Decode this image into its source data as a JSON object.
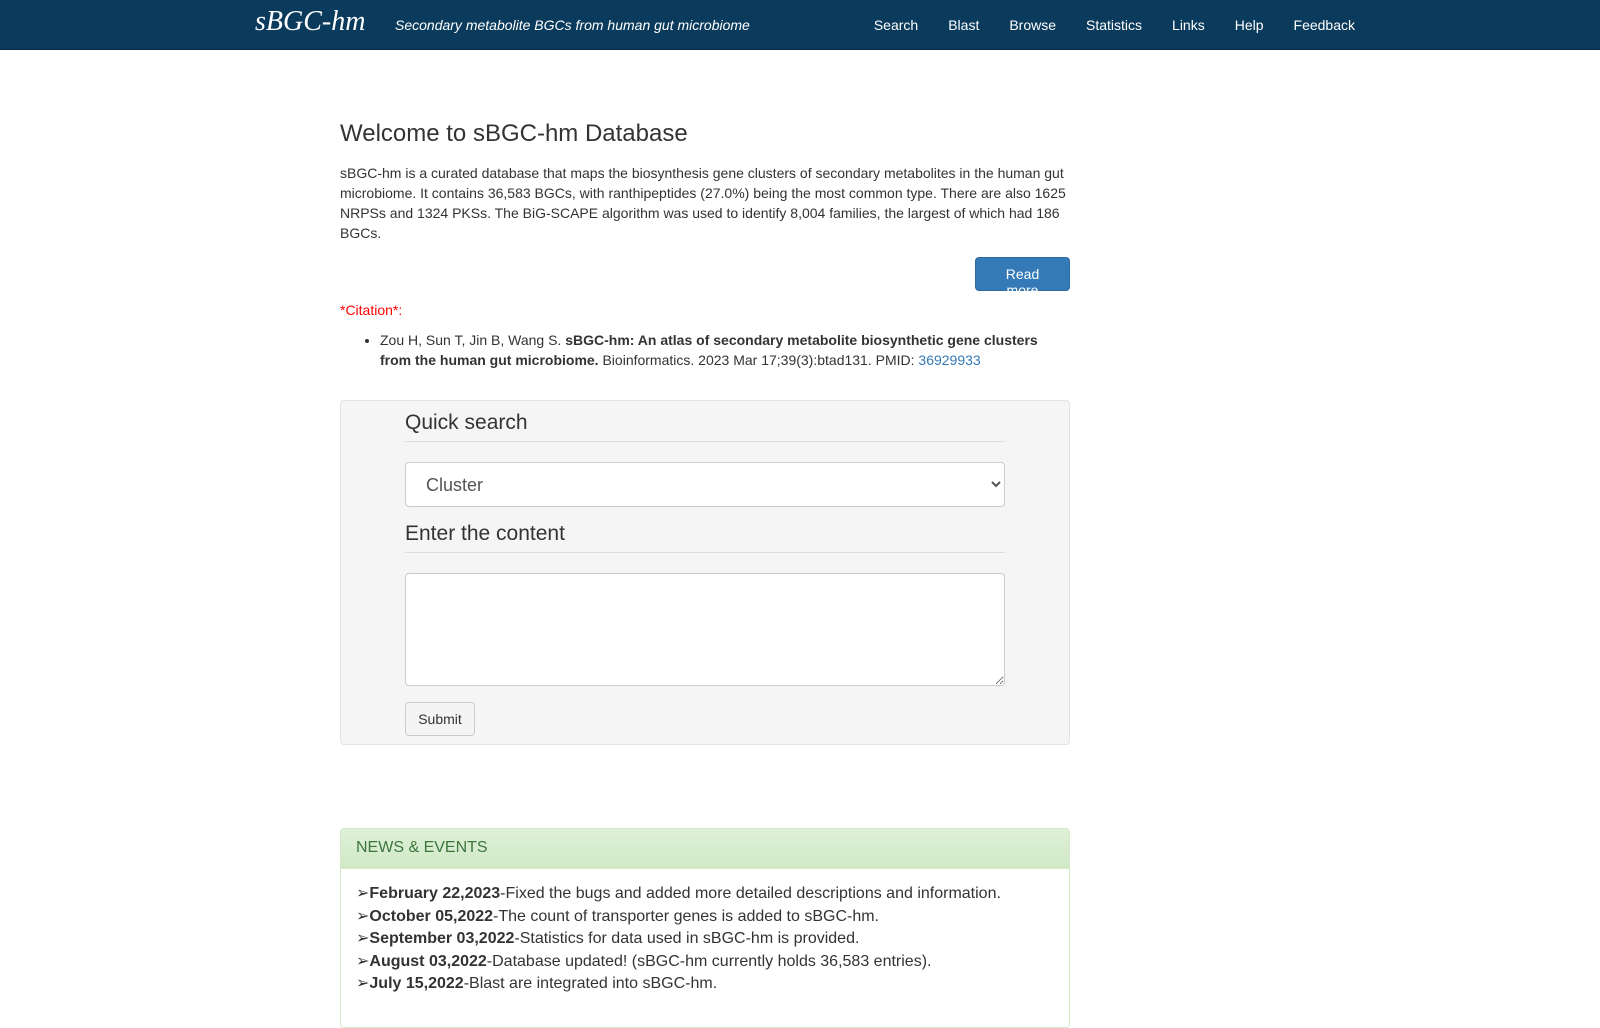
{
  "navbar": {
    "brand": "sBGC-hm",
    "tagline": "Secondary metabolite BGCs from human gut microbiome",
    "links": [
      "Search",
      "Blast",
      "Browse",
      "Statistics",
      "Links",
      "Help",
      "Feedback"
    ]
  },
  "welcome": {
    "title": "Welcome to sBGC-hm Database",
    "intro": "sBGC-hm is a curated database that maps the biosynthesis gene clusters of secondary metabolites in the human gut microbiome. It contains 36,583 BGCs, with ranthipeptides (27.0%) being the most common type. There are also 1625 NRPSs and 1324 PKSs. The BiG-SCAPE algorithm was used to identify 8,004 families, the largest of which had 186 BGCs.",
    "read_more": "Read more"
  },
  "citation": {
    "label": "*Citation*:",
    "authors": "Zou H, Sun T, Jin B, Wang S. ",
    "title": "sBGC-hm: An atlas of secondary metabolite biosynthetic gene clusters from the human gut microbiome.",
    "journal": " Bioinformatics. 2023 Mar 17;39(3):btad131. PMID: ",
    "pmid": "36929933"
  },
  "quick_search": {
    "heading": "Quick search",
    "selected_option": "Cluster",
    "content_heading": "Enter the content",
    "textarea_value": "",
    "submit_label": "Submit"
  },
  "news": {
    "heading": "NEWS & EVENTS",
    "bullet": "➢",
    "items": [
      {
        "date": "February 22,2023",
        "text": "-Fixed the bugs and added more detailed descriptions and information."
      },
      {
        "date": "October 05,2022",
        "text": "-The count of transporter genes is added to sBGC-hm."
      },
      {
        "date": "September 03,2022",
        "text": "-Statistics for data used in sBGC-hm is provided."
      },
      {
        "date": "August 03,2022",
        "text": "-Database updated! (sBGC-hm currently holds 36,583 entries)."
      },
      {
        "date": "July 15,2022",
        "text": "-Blast are integrated into sBGC-hm."
      }
    ]
  }
}
